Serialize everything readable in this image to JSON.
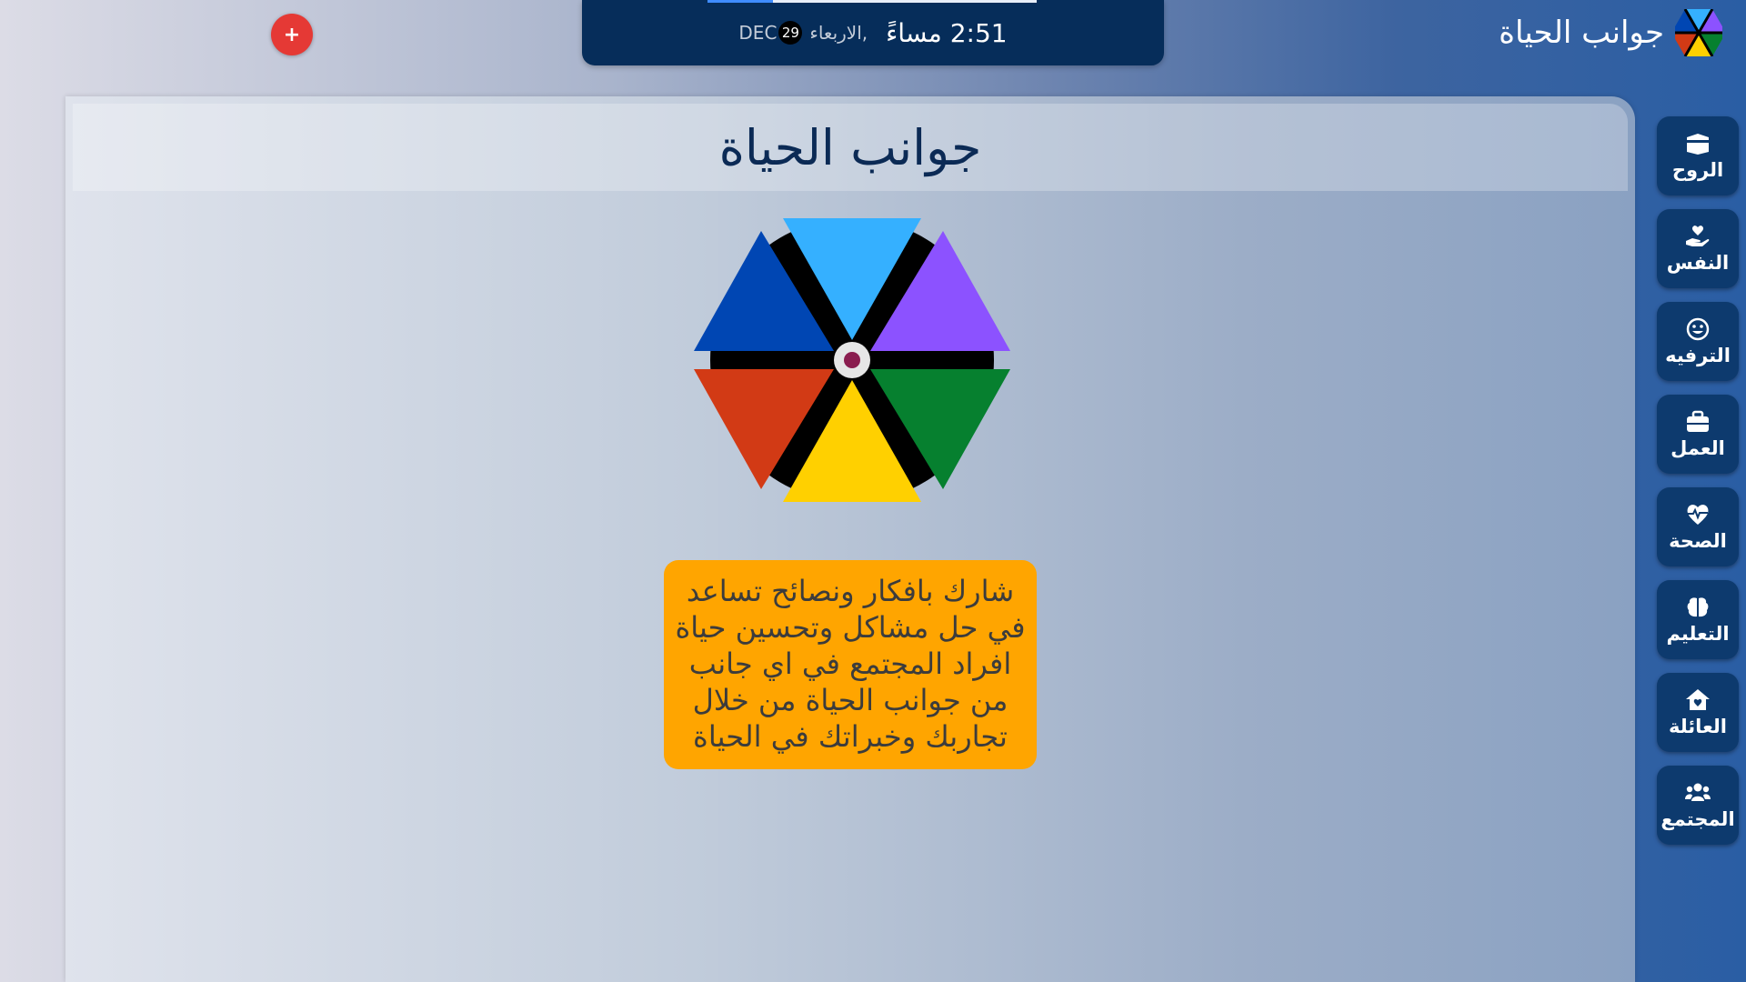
{
  "header": {
    "brand_title": "جوانب الحياة",
    "time": "2:51 مساءً",
    "weekday": "الاربعاء,",
    "day": "29",
    "month": "DEC",
    "add_button": "+"
  },
  "main": {
    "title": "جوانب الحياة",
    "info_lines": [
      "شارك بافكار ونصائح تساعد",
      "في حل مشاكل وتحسين حياة",
      "افراد المجتمع في اي جانب",
      "من جوانب الحياة من خلال",
      "تجاربك وخبراتك في الحياة"
    ]
  },
  "wheel": {
    "segment_colors": [
      "#35b0ff",
      "#8c52ff",
      "#06802f",
      "#ffd000",
      "#d23a15",
      "#0046b3"
    ],
    "center_color": "#8a1d4f"
  },
  "sidebar": {
    "items": [
      {
        "label": "الروح",
        "icon": "kaaba-icon"
      },
      {
        "label": "النفس",
        "icon": "hand-holding-heart-icon"
      },
      {
        "label": "الترفيه",
        "icon": "smile-icon"
      },
      {
        "label": "العمل",
        "icon": "briefcase-icon"
      },
      {
        "label": "الصحة",
        "icon": "heartbeat-icon"
      },
      {
        "label": "التعليم",
        "icon": "brain-icon"
      },
      {
        "label": "العائلة",
        "icon": "home-heart-icon"
      },
      {
        "label": "المجتمع",
        "icon": "users-icon"
      }
    ]
  }
}
